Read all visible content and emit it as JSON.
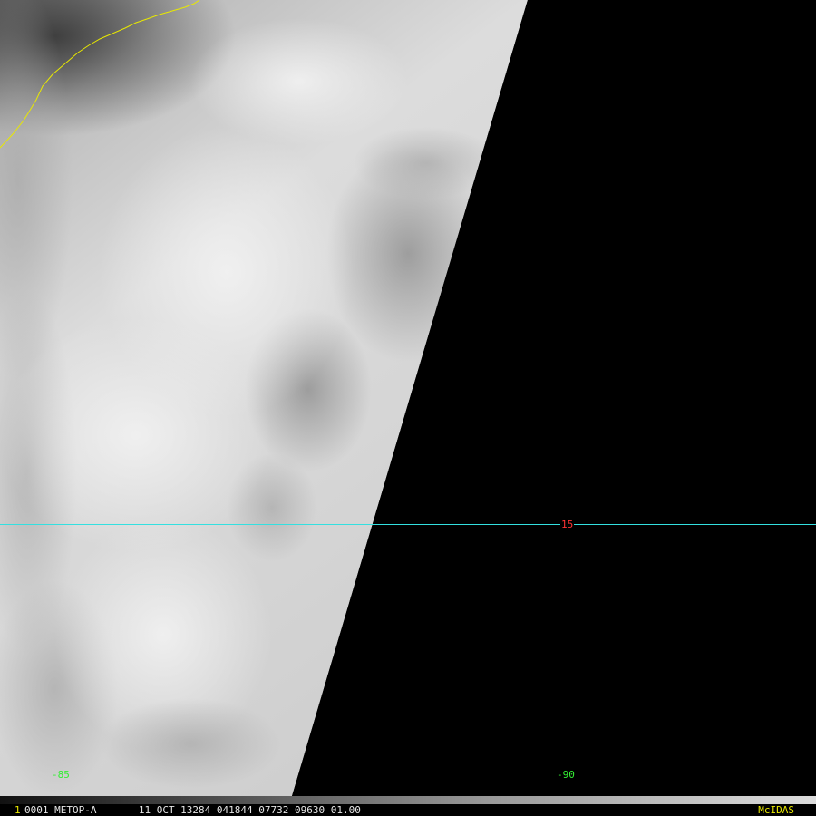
{
  "colors": {
    "grid": "#33e0e0",
    "coastline": "#e8e800",
    "lon_label": "#33ee33",
    "lat_label": "#ff3333",
    "frame_number": "#e8e800",
    "status_text": "#e6e6e6",
    "software_label": "#e8e800",
    "background": "#000000"
  },
  "grid_labels": {
    "lon_85": "-85",
    "lon_90": "-90",
    "lat_15": "15"
  },
  "status_bar": {
    "frame_number": "1",
    "info": "0001 METOP-A       11 OCT 13284 041844 07732 09630 01.00",
    "software": "McIDAS"
  }
}
